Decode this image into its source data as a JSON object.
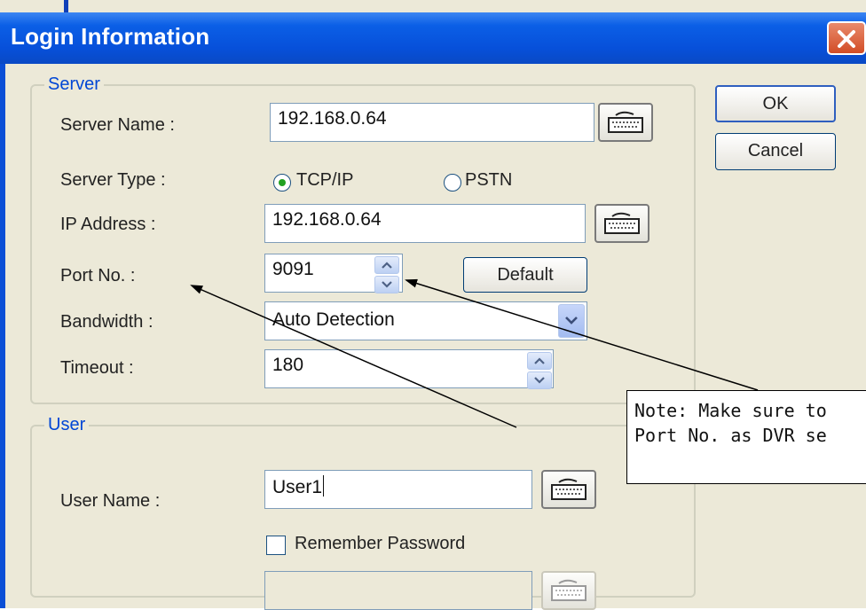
{
  "window": {
    "title": "Login Information",
    "close_icon": "close-x-icon"
  },
  "server_group": {
    "legend": "Server",
    "server_name": {
      "label": "Server Name :",
      "value": "192.168.0.64"
    },
    "server_type": {
      "label": "Server Type :",
      "options": [
        "TCP/IP",
        "PSTN"
      ],
      "selected": "TCP/IP"
    },
    "ip_address": {
      "label": "IP Address :",
      "value": "192.168.0.64"
    },
    "port": {
      "label": "Port No. :",
      "value": "9091",
      "default_label": "Default"
    },
    "bandwidth": {
      "label": "Bandwidth :",
      "value": "Auto Detection"
    },
    "timeout": {
      "label": "Timeout :",
      "value": "180"
    }
  },
  "user_group": {
    "legend": "User",
    "user_name": {
      "label": "User Name :",
      "value": "User1"
    },
    "remember_password": {
      "label": "Remember Password",
      "checked": false
    },
    "password": {
      "value": ""
    }
  },
  "buttons": {
    "ok": "OK",
    "cancel": "Cancel"
  },
  "note": {
    "line1": "Note: Make sure to",
    "line2": "Port No. as DVR se"
  },
  "icons": {
    "keyboard": "keyboard-icon",
    "spin_up": "spin-up-icon",
    "spin_down": "spin-down-icon",
    "dropdown": "chevron-down-icon"
  },
  "colors": {
    "title_bar": "#0a5ae0",
    "legend_text": "#0046d5",
    "dialog_bg": "#ece9d8",
    "radio_dot": "#21a121",
    "close_button": "#d9582f"
  }
}
